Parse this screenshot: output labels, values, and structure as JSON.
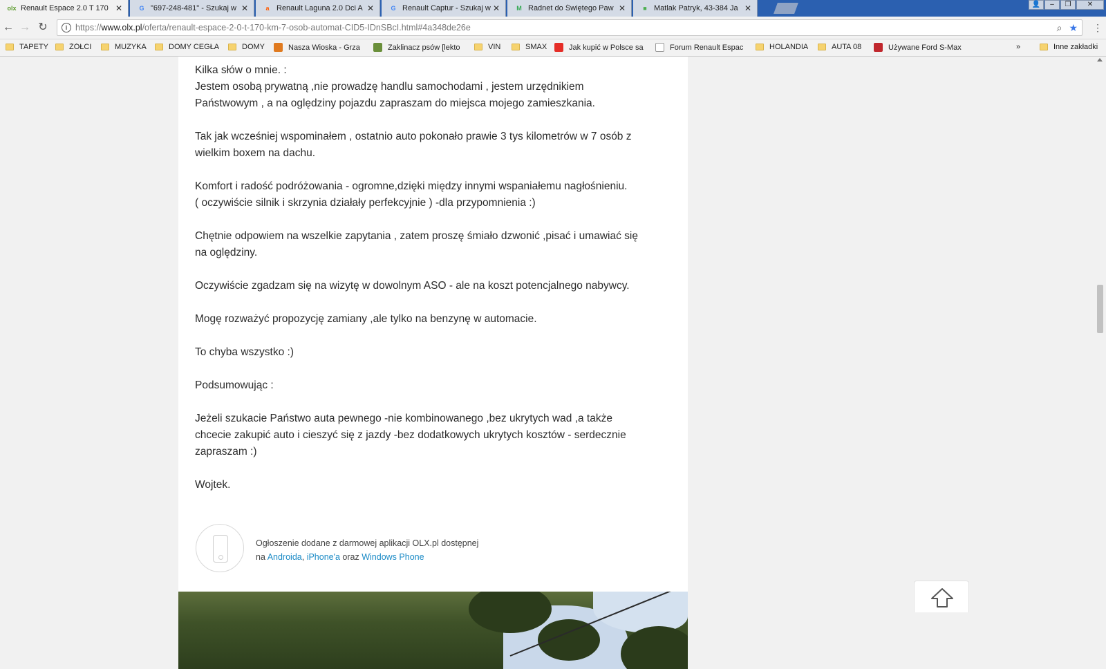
{
  "tabs": [
    {
      "label": "Renault Espace 2.0 T 170",
      "favicon": "olx-favicon",
      "fav_text": "olx",
      "fav_color": "#5b9b2b"
    },
    {
      "label": "\"697-248-481\" - Szukaj w",
      "favicon": "google-favicon",
      "fav_text": "G",
      "fav_color": "#4285f4"
    },
    {
      "label": "Renault Laguna 2.0 Dci A",
      "favicon": "allegro-favicon",
      "fav_text": "a",
      "fav_color": "#ff5a00"
    },
    {
      "label": "Renault Captur - Szukaj w",
      "favicon": "google-favicon",
      "fav_text": "G",
      "fav_color": "#4285f4"
    },
    {
      "label": "Radnet do Świętego Paw",
      "favicon": "maps-favicon",
      "fav_text": "M",
      "fav_color": "#34a853"
    },
    {
      "label": "Matlak Patryk, 43-384 Ja",
      "favicon": "maps-green-favicon",
      "fav_text": "■",
      "fav_color": "#4caf50"
    }
  ],
  "address": {
    "scheme": "https://",
    "host": "www.olx.pl",
    "path": "/oferta/renault-espace-2-0-t-170-km-7-osob-automat-CID5-IDnSBcI.html#4a348de26e"
  },
  "bookmarks": [
    {
      "label": "TAPETY",
      "type": "folder"
    },
    {
      "label": "ŻÓŁCI",
      "type": "folder"
    },
    {
      "label": "MUZYKA",
      "type": "folder"
    },
    {
      "label": "DOMY CEGŁA",
      "type": "folder"
    },
    {
      "label": "DOMY",
      "type": "folder"
    },
    {
      "label": "Nasza Wioska - Grza",
      "type": "site",
      "icon_color": "#e07a1f"
    },
    {
      "label": "Zaklinacz psów [lekto",
      "type": "site",
      "icon_color": "#6a8f3a"
    },
    {
      "label": "VIN",
      "type": "folder"
    },
    {
      "label": "SMAX",
      "type": "folder"
    },
    {
      "label": "Jak kupić w Polsce sa",
      "type": "site",
      "icon_color": "#e52d27"
    },
    {
      "label": "Forum Renault Espac",
      "type": "page"
    },
    {
      "label": "HOLANDIA",
      "type": "folder"
    },
    {
      "label": "AUTA 08",
      "type": "folder"
    },
    {
      "label": "Używane Ford S-Max",
      "type": "site",
      "icon_color": "#c0272d"
    },
    {
      "label": "»",
      "type": "more"
    },
    {
      "label": "Inne zakładki",
      "type": "folder"
    }
  ],
  "description": {
    "lines": [
      "Kilka słów o mnie. :",
      "Jestem osobą prywatną ,nie prowadzę handlu samochodami , jestem urzędnikiem",
      "Państwowym , a na oględziny pojazdu zapraszam do miejsca mojego zamieszkania.",
      "",
      "Tak jak wcześniej wspominałem , ostatnio auto pokonało prawie 3 tys kilometrów w 7 osób z",
      "wielkim boxem na dachu.",
      "",
      "Komfort i radość podróżowania - ogromne,dzięki między innymi wspaniałemu nagłośnieniu.",
      "( oczywiście silnik i skrzynia działały perfekcyjnie ) -dla przypomnienia :)",
      "",
      "Chętnie odpowiem na wszelkie zapytania , zatem proszę śmiało dzwonić ,pisać i umawiać się",
      "na oględziny.",
      "",
      "Oczywiście zgadzam się na wizytę w dowolnym ASO - ale na koszt potencjalnego nabywcy.",
      "",
      "Mogę rozważyć propozycję zamiany ,ale tylko na benzynę w automacie.",
      "",
      "To chyba wszystko :)",
      "",
      "Podsumowując :",
      "",
      "Jeżeli szukacie Państwo auta pewnego -nie kombinowanego ,bez ukrytych wad ,a także",
      "chcecie zakupić auto i cieszyć się z jazdy -bez dodatkowych ukrytych kosztów - serdecznie",
      "zapraszam :)",
      "",
      "Wojtek."
    ]
  },
  "app_promo": {
    "line1": "Ogłoszenie dodane z darmowej aplikacji OLX.pl dostępnej",
    "prefix": "na ",
    "link_android": "Androida",
    "sep1": ", ",
    "link_iphone": "iPhone'a",
    "sep2": " oraz ",
    "link_windows": "Windows Phone"
  },
  "colors": {
    "link": "#1a8ac6",
    "tabstrip": "#2b60b0",
    "bookmark_star": "#3b78e7"
  }
}
